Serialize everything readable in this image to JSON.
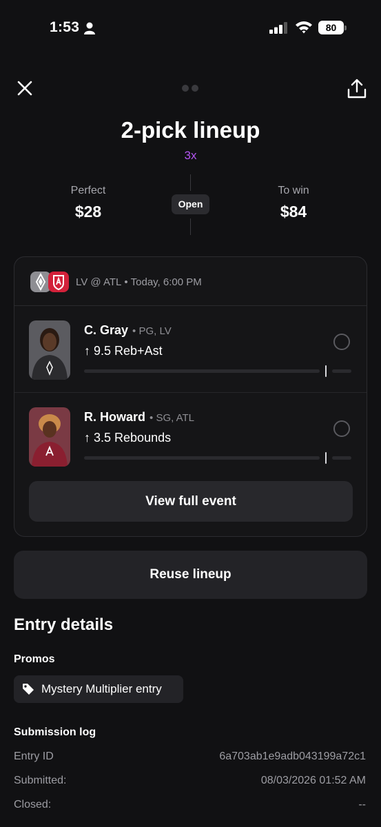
{
  "status_bar": {
    "time": "1:53",
    "battery": "80"
  },
  "header": {
    "title": "2-pick lineup",
    "multiplier": "3x"
  },
  "stats": {
    "perfect_label": "Perfect",
    "perfect_value": "$28",
    "status_badge": "Open",
    "to_win_label": "To win",
    "to_win_value": "$84"
  },
  "event": {
    "matchup": "LV @ ATL",
    "datetime": "Today, 6:00 PM",
    "players": [
      {
        "name": "C. Gray",
        "meta": "PG, LV",
        "projection": "9.5 Reb+Ast"
      },
      {
        "name": "R. Howard",
        "meta": "SG, ATL",
        "projection": "3.5 Rebounds"
      }
    ],
    "view_button": "View full event"
  },
  "reuse_button": "Reuse lineup",
  "entry_details": {
    "title": "Entry details",
    "promos_title": "Promos",
    "promo": "Mystery Multiplier entry",
    "log_title": "Submission log",
    "log": [
      {
        "label": "Entry ID",
        "value": "6a703ab1e9adb043199a72c1"
      },
      {
        "label": "Submitted:",
        "value": "08/03/2026 01:52 AM"
      },
      {
        "label": "Closed:",
        "value": "--"
      }
    ]
  },
  "colors": {
    "background": "#111113",
    "accent": "#b455f2",
    "card": "#151517",
    "button": "#232327"
  },
  "icons": [
    "close-icon",
    "share-icon",
    "tag-icon",
    "person-icon",
    "signal-icon",
    "wifi-icon",
    "up-arrow-icon"
  ]
}
